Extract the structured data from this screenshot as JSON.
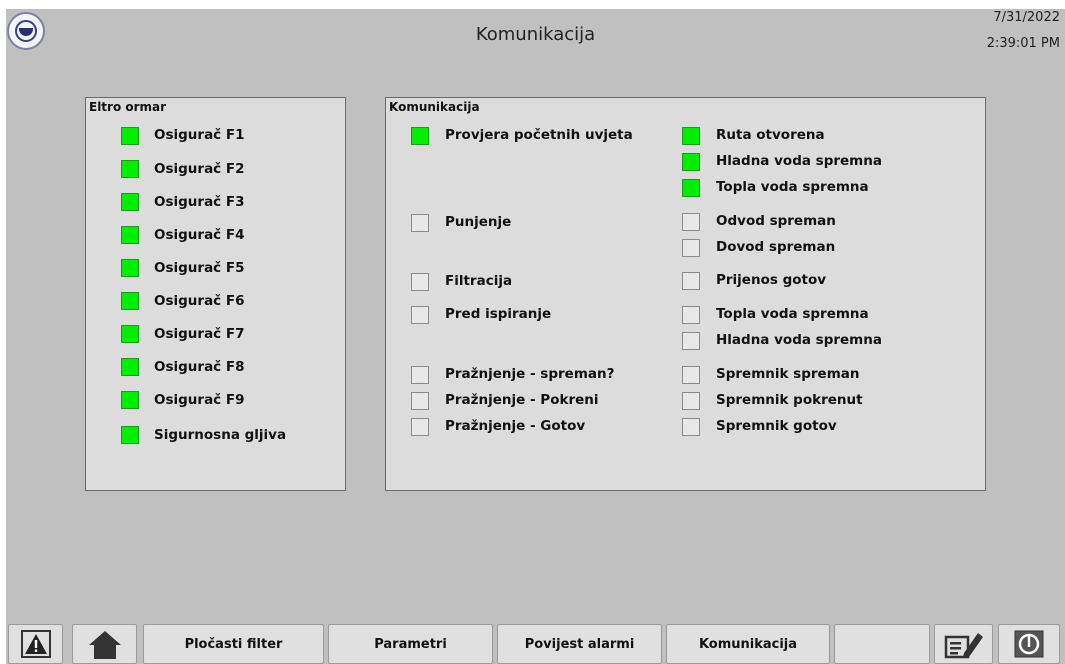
{
  "header": {
    "title": "Komunikacija",
    "date": "7/31/2022",
    "time": "2:39:01 PM",
    "logo_icon": "organization-logo-icon"
  },
  "colors": {
    "on": "#00ee00",
    "off": "#e8e8e8",
    "background": "#c0c0c0",
    "panel": "#dcdcdc"
  },
  "eltro_panel": {
    "title": "Eltro ormar",
    "items": [
      {
        "label": "Osigurač F1",
        "state": "on"
      },
      {
        "label": "Osigurač F2",
        "state": "on"
      },
      {
        "label": "Osigurač F3",
        "state": "on"
      },
      {
        "label": "Osigurač F4",
        "state": "on"
      },
      {
        "label": "Osigurač F5",
        "state": "on"
      },
      {
        "label": "Osigurač F6",
        "state": "on"
      },
      {
        "label": "Osigurač F7",
        "state": "on"
      },
      {
        "label": "Osigurač F8",
        "state": "on"
      },
      {
        "label": "Osigurač F9",
        "state": "on"
      },
      {
        "label": "Sigurnosna gljiva",
        "state": "on"
      }
    ]
  },
  "comm_panel": {
    "title": "Komunikacija",
    "left_items": [
      {
        "label": "Provjera početnih uvjeta",
        "state": "on"
      },
      {
        "label": "Punjenje",
        "state": "off"
      },
      {
        "label": "Filtracija",
        "state": "off"
      },
      {
        "label": "Pred ispiranje",
        "state": "off"
      },
      {
        "label": "Pražnjenje - spreman?",
        "state": "off"
      },
      {
        "label": "Pražnjenje - Pokreni",
        "state": "off"
      },
      {
        "label": "Pražnjenje - Gotov",
        "state": "off"
      }
    ],
    "right_items": [
      {
        "label": "Ruta otvorena",
        "state": "on"
      },
      {
        "label": "Hladna voda spremna",
        "state": "on"
      },
      {
        "label": "Topla voda spremna",
        "state": "on"
      },
      {
        "label": "Odvod spreman",
        "state": "off"
      },
      {
        "label": "Dovod spreman",
        "state": "off"
      },
      {
        "label": "Prijenos gotov",
        "state": "off"
      },
      {
        "label": "Topla voda spremna",
        "state": "off"
      },
      {
        "label": "Hladna voda spremna",
        "state": "off"
      },
      {
        "label": "Spremnik spreman",
        "state": "off"
      },
      {
        "label": "Spremnik pokrenut",
        "state": "off"
      },
      {
        "label": "Spremnik gotov",
        "state": "off"
      }
    ]
  },
  "nav": {
    "alarm_icon": "alarm-warning-icon",
    "home_icon": "home-icon",
    "buttons": [
      "Pločasti filter",
      "Parametri",
      "Povijest alarmi",
      "Komunikacija",
      ""
    ],
    "edit_icon": "edit-notes-icon",
    "power_icon": "power-icon"
  }
}
